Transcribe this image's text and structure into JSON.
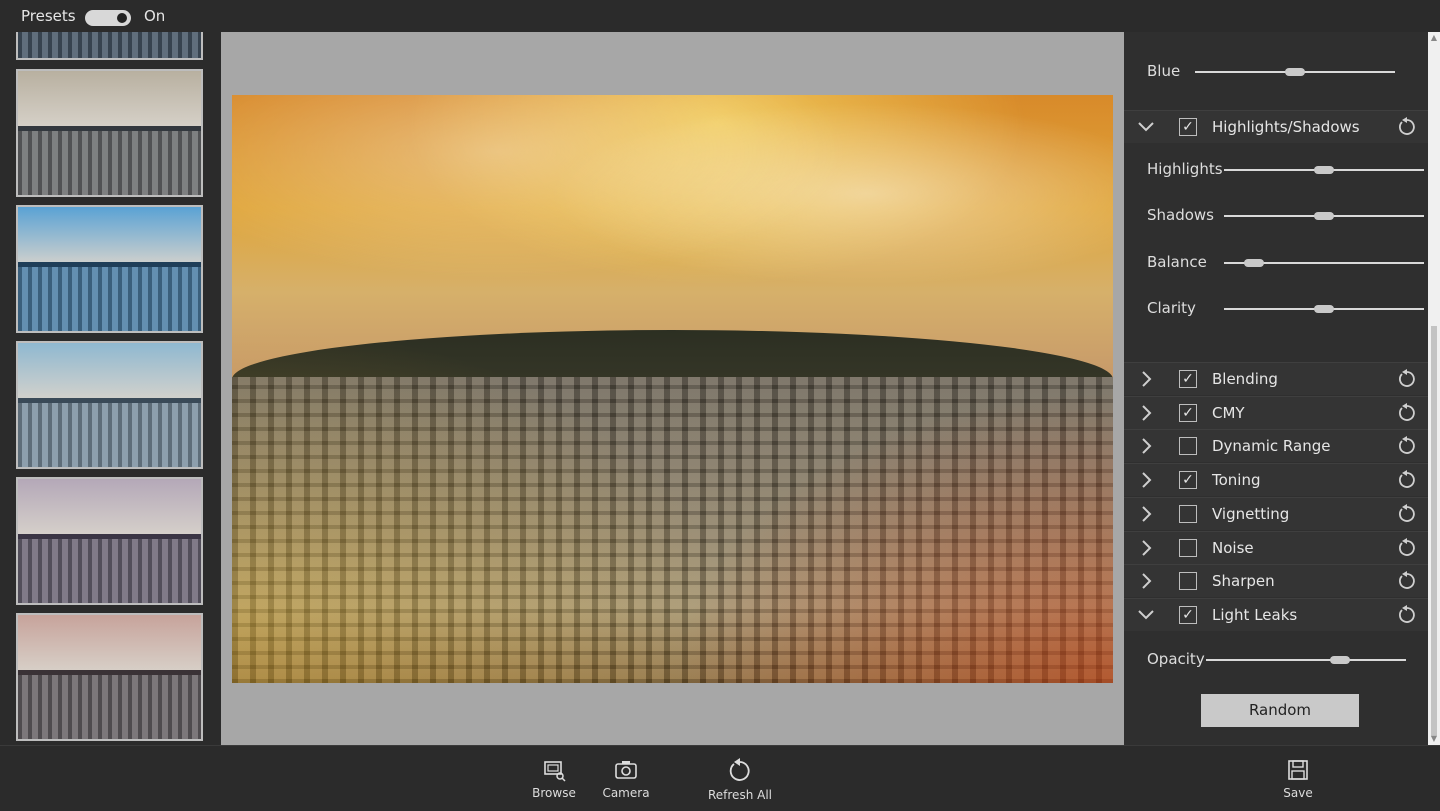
{
  "topbar": {
    "presets_label": "Presets",
    "toggle_state": "On"
  },
  "presets": {
    "thumbnails": [
      {
        "sky": "#3b5b7a",
        "land": "#4a5a6a",
        "hill": "#22303c"
      },
      {
        "sky": "#b8b0a0",
        "land": "#6c6e70",
        "hill": "#33383e"
      },
      {
        "sky": "#5aa2d4",
        "land": "#4d7fa6",
        "hill": "#1f3e58"
      },
      {
        "sky": "#8fb8d0",
        "land": "#7d92a2",
        "hill": "#3a4a58"
      },
      {
        "sky": "#b4a8b8",
        "land": "#6e6878",
        "hill": "#3a3444"
      },
      {
        "sky": "#c7a39b",
        "land": "#6a6468",
        "hill": "#3a3236"
      }
    ]
  },
  "panel": {
    "blue": {
      "label": "Blue",
      "value": 0.5
    },
    "highlights_shadows": {
      "title": "Highlights/Shadows",
      "checked": true,
      "expanded": true,
      "sliders": [
        {
          "label": "Highlights",
          "value": 0.5
        },
        {
          "label": "Shadows",
          "value": 0.5
        },
        {
          "label": "Balance",
          "value": 0.15
        },
        {
          "label": "Clarity",
          "value": 0.5
        }
      ]
    },
    "sections": [
      {
        "title": "Blending",
        "checked": true,
        "expanded": false
      },
      {
        "title": "CMY",
        "checked": true,
        "expanded": false
      },
      {
        "title": "Dynamic Range",
        "checked": false,
        "expanded": false
      },
      {
        "title": "Toning",
        "checked": true,
        "expanded": false
      },
      {
        "title": "Vignetting",
        "checked": false,
        "expanded": false
      },
      {
        "title": "Noise",
        "checked": false,
        "expanded": false
      },
      {
        "title": "Sharpen",
        "checked": false,
        "expanded": false
      },
      {
        "title": "Light Leaks",
        "checked": true,
        "expanded": true
      }
    ],
    "opacity": {
      "label": "Opacity",
      "value": 0.67
    },
    "random_label": "Random"
  },
  "toolbar": {
    "browse": "Browse",
    "camera": "Camera",
    "refresh_all": "Refresh All",
    "save": "Save"
  },
  "colors": {
    "panel_bg": "#2f2f2f",
    "canvas_bg": "#a7a7a7",
    "accent": "#c9c9c9"
  }
}
